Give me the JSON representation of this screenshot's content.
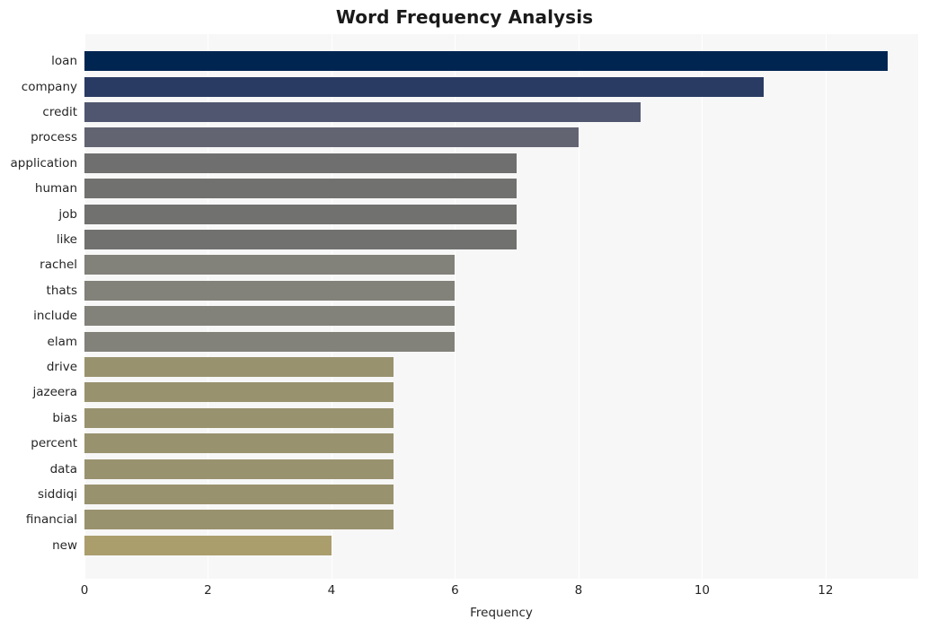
{
  "chart_data": {
    "type": "bar",
    "orientation": "horizontal",
    "title": "Word Frequency Analysis",
    "xlabel": "Frequency",
    "ylabel": "",
    "categories": [
      "loan",
      "company",
      "credit",
      "process",
      "application",
      "human",
      "job",
      "like",
      "rachel",
      "thats",
      "include",
      "elam",
      "drive",
      "jazeera",
      "bias",
      "percent",
      "data",
      "siddiqi",
      "financial",
      "new"
    ],
    "values": [
      13,
      11,
      9,
      8,
      7,
      7,
      7,
      7,
      6,
      6,
      6,
      6,
      5,
      5,
      5,
      5,
      5,
      5,
      5,
      4
    ],
    "bar_colors": [
      "#012551",
      "#2a3b63",
      "#515670",
      "#636472",
      "#6f6f70",
      "#717170",
      "#717170",
      "#717170",
      "#82817a",
      "#82817a",
      "#82817a",
      "#82817a",
      "#99926f",
      "#99926f",
      "#99926f",
      "#99926f",
      "#99926f",
      "#99926f",
      "#99926f",
      "#aa9e6d"
    ],
    "xlim": [
      0,
      13.5
    ],
    "xticks": [
      0,
      2,
      4,
      6,
      8,
      10,
      12
    ],
    "xtick_labels": [
      "0",
      "2",
      "4",
      "6",
      "8",
      "10",
      "12"
    ],
    "grid": true,
    "grid_axis": "x",
    "grid_color": "#ffffff",
    "legend": false,
    "plot_background": "#f7f7f7",
    "figure_background": "#ffffff",
    "title_color": "#1a1a1a",
    "tick_label_color": "#262626"
  }
}
